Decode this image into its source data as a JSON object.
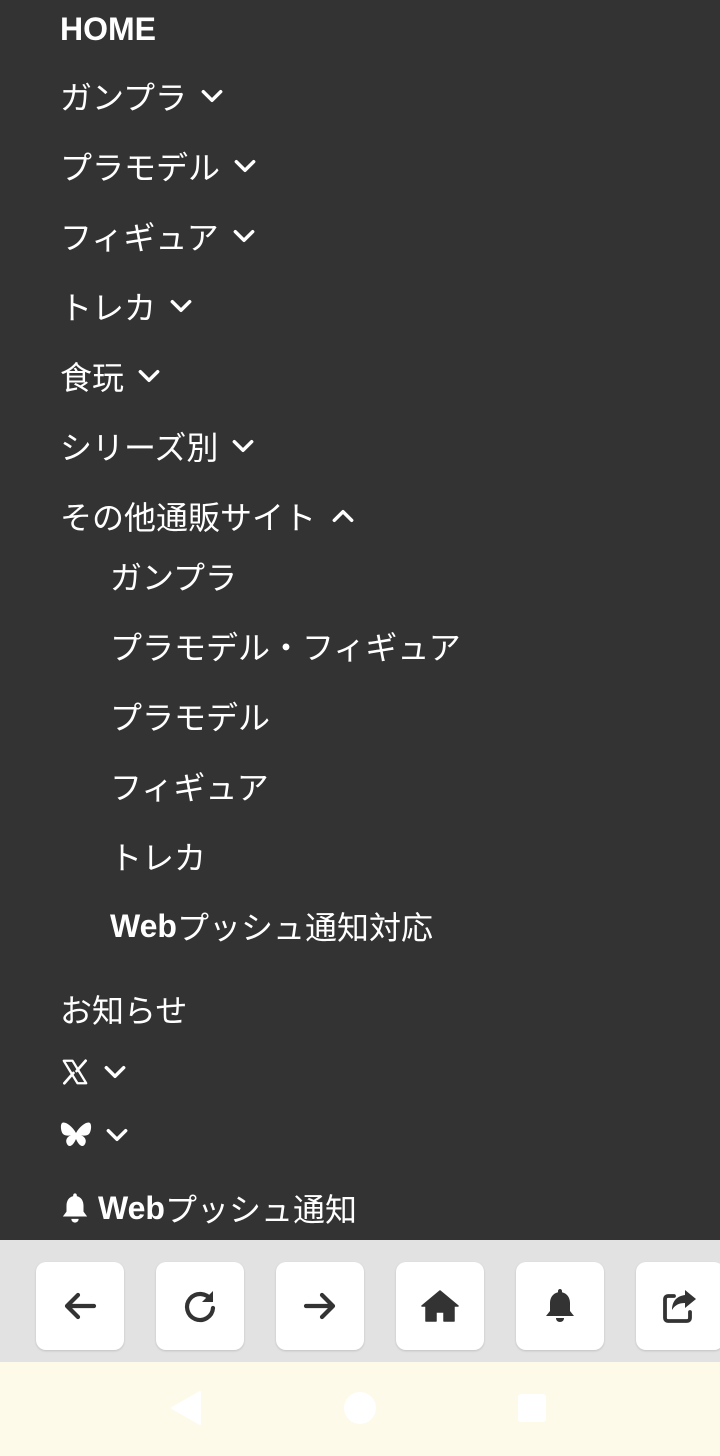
{
  "menu": {
    "home": "HOME",
    "gunpla": "ガンプラ",
    "plamodel": "プラモデル",
    "figure": "フィギュア",
    "toreka": "トレカ",
    "shokugan": "食玩",
    "series": "シリーズ別",
    "other": "その他通販サイト",
    "other_items": [
      "ガンプラ",
      "プラモデル・フィギュア",
      "プラモデル",
      "フィギュア",
      "トレカ"
    ],
    "webpush_support_prefix": "Web",
    "webpush_support_suffix": "プッシュ通知対応",
    "news": "お知らせ",
    "webpush_prefix": "Web",
    "webpush_suffix": "プッシュ通知"
  },
  "icons": {
    "x": "x-logo-icon",
    "bluesky": "bluesky-butterfly-icon",
    "bell": "bell-icon"
  },
  "toolbar": {
    "buttons": [
      "back-arrow-icon",
      "reload-icon",
      "forward-arrow-icon",
      "home-icon",
      "bell-icon",
      "share-icon"
    ]
  },
  "colors": {
    "menu_bg": "#333333",
    "text": "#ffffff",
    "toolbar_bg": "#e2e2e2",
    "button_bg": "#ffffff",
    "icon": "#333333",
    "navbar_bg": "#fdfaea"
  }
}
